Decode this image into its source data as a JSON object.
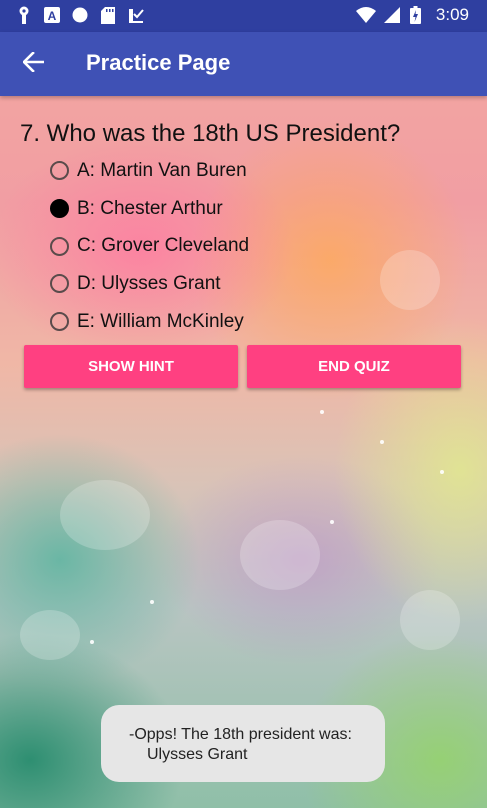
{
  "status_bar": {
    "time": "3:09",
    "left_icons": [
      "key-icon",
      "a-box-icon",
      "circle-icon",
      "sd-card-icon",
      "tray-check-icon"
    ],
    "right_icons": [
      "wifi-icon",
      "signal-icon",
      "battery-charging-icon"
    ]
  },
  "app_bar": {
    "title": "Practice Page",
    "back_icon": "arrow-left-icon"
  },
  "question": {
    "text": "7. Who was the 18th US President?",
    "options": [
      {
        "label": "A: Martin Van Buren",
        "selected": false
      },
      {
        "label": "B: Chester Arthur",
        "selected": true
      },
      {
        "label": "C: Grover Cleveland",
        "selected": false
      },
      {
        "label": "D: Ulysses Grant",
        "selected": false
      },
      {
        "label": "E: William McKinley",
        "selected": false
      }
    ]
  },
  "buttons": {
    "hint_label": "SHOW HINT",
    "end_label": "END QUIZ",
    "accent_color": "#ff4081"
  },
  "toast": {
    "line1": "-Opps! The 18th president was:",
    "line2": "Ulysses Grant"
  },
  "colors": {
    "app_bar": "#3f51b5",
    "status_bar": "#2f3fa0"
  }
}
